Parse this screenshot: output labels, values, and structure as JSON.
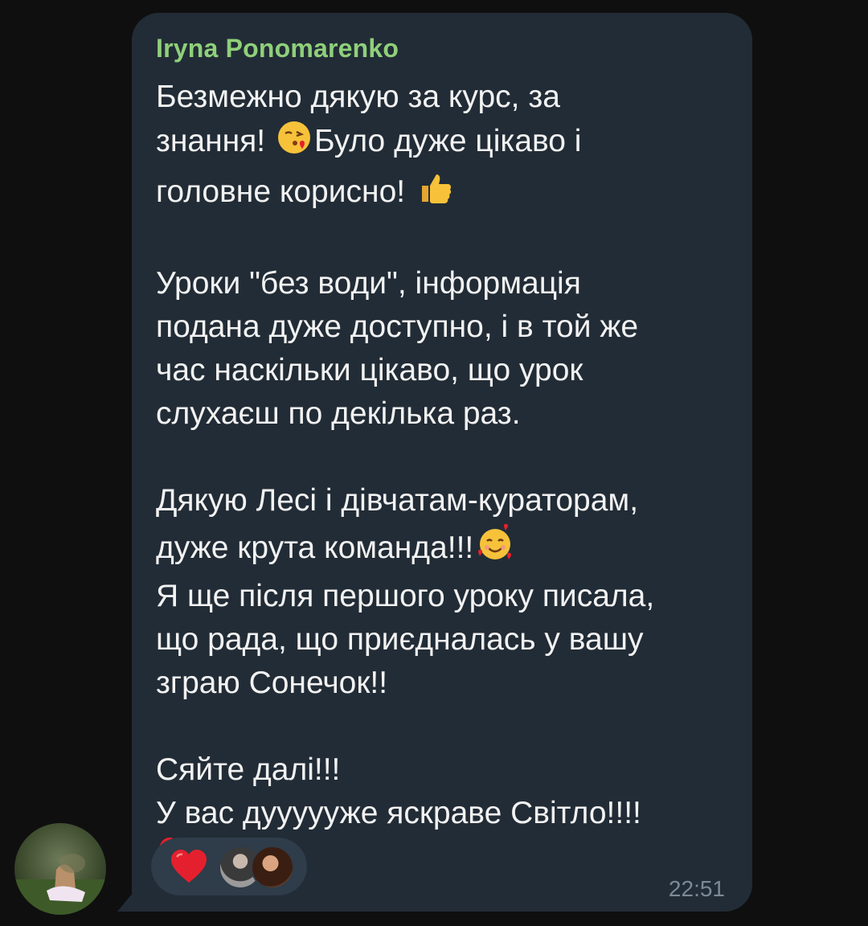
{
  "message": {
    "sender": "Iryna Ponomarenko",
    "lines": [
      "Безмежно дякую за курс, за",
      "знання! ",
      "Було дуже цікаво і",
      "головне корисно! ",
      "",
      "Уроки \"без води\",  інформація",
      "подана дуже доступно, і в той же",
      "час наскільки цікаво, що урок",
      "слухаєш по декілька раз.",
      "",
      "Дякую Лесі і дівчатам-кураторам,",
      "дуже крута команда!!!",
      "Я ще після першого уроку писала,",
      "що рада, що приєдналась у вашу",
      "зграю Сонечок!!",
      "",
      "Сяйте далі!!!",
      "У вас дуууууже яскраве Світло!!!!"
    ],
    "emojis": {
      "kiss": "face-blowing-kiss-emoji",
      "thumbs": "thumbs-up-emoji",
      "hearts": "smiling-face-with-hearts-emoji",
      "heart": "red-heart-emoji"
    },
    "time": "22:51"
  },
  "reactions": {
    "emoji": "red-heart-icon",
    "reactors": [
      "reactor-avatar-1",
      "reactor-avatar-2"
    ]
  },
  "colors": {
    "background": "#0f0f0f",
    "bubble": "#222c36",
    "sender": "#8fd07a",
    "text": "#f2f2f2",
    "time": "#7c8a97",
    "reaction_pill": "#2f3c49",
    "heart": "#e5202e"
  }
}
